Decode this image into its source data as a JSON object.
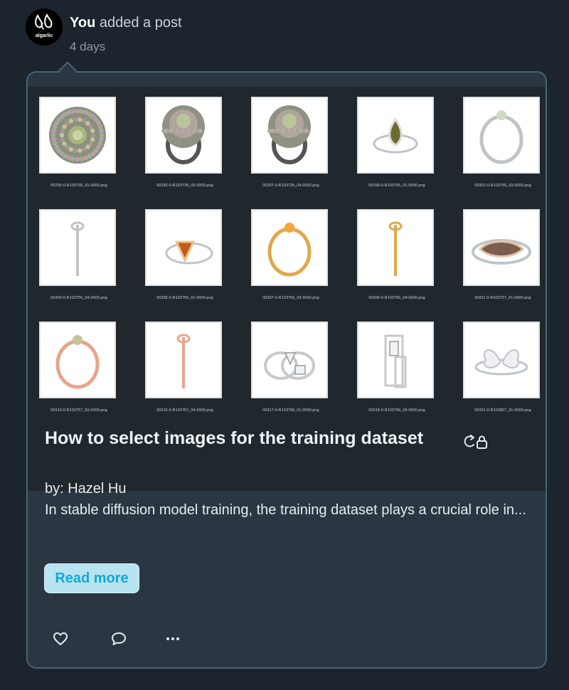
{
  "activity": {
    "actor": "You",
    "action": "added a post",
    "time": "4 days",
    "avatar_icon": "algarlic-logo-icon",
    "avatar_text": "algarlic"
  },
  "post": {
    "title": "How to select images for the training dataset",
    "title_icon": "refresh-lock-icon",
    "author": "by: Hazel Hu",
    "excerpt": "In stable diffusion model training, the training dataset plays a crucial role in...",
    "read_more": "Read more"
  },
  "cover_images": [
    {
      "file": "00293-0-R103739_01-0000.png",
      "kind": "cluster"
    },
    {
      "file": "00295-0-R103739_03-0000.png",
      "kind": "cluster-side"
    },
    {
      "file": "00297-0-R103739_04-0000.png",
      "kind": "cluster-side"
    },
    {
      "file": "00299-0-R103755_01-0000.png",
      "kind": "pear"
    },
    {
      "file": "00301-0-R103755_03-0000.png",
      "kind": "band-silver"
    },
    {
      "file": "00303-0-R103755_04-0000.png",
      "kind": "edge-silver"
    },
    {
      "file": "00305-0-R103756_01-0000.png",
      "kind": "trillion"
    },
    {
      "file": "00307-0-R103756_03-0000.png",
      "kind": "band-gold"
    },
    {
      "file": "00309-0-R103756_04-0000.png",
      "kind": "edge-gold"
    },
    {
      "file": "00311-0-R103757_01-0000.png",
      "kind": "marquise"
    },
    {
      "file": "00313-0-R103757_03-0000.png",
      "kind": "band-rose"
    },
    {
      "file": "00315-0-R103757_04-0000.png",
      "kind": "edge-rose"
    },
    {
      "file": "00317-0-R103796_01-0000.png",
      "kind": "stack"
    },
    {
      "file": "00319-0-R103796_03-0000.png",
      "kind": "stack-side"
    },
    {
      "file": "00321-0-R103807_01-0000.png",
      "kind": "butterfly"
    }
  ],
  "colors": {
    "background": "#1c252e",
    "card": "#2a3742",
    "card_border": "#4a6372",
    "accent": "#12a8dc",
    "button_bg": "#b8e3f1"
  },
  "actions": [
    {
      "name": "like",
      "icon": "heart-icon"
    },
    {
      "name": "comment",
      "icon": "comment-icon"
    },
    {
      "name": "more",
      "icon": "more-dots-icon"
    }
  ]
}
